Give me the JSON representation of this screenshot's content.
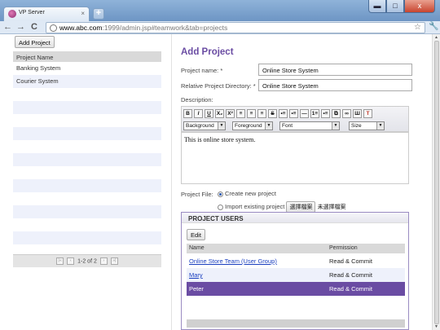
{
  "browser": {
    "tab_title": "VP Server",
    "tab_close": "×",
    "new_tab": "+",
    "url_host": "www.abc.com",
    "url_path": ":1999/admin.jsp#teamwork&tab=projects",
    "back": "←",
    "forward": "→",
    "reload": "C",
    "star": "☆",
    "wrench": "🔧",
    "min": "▬",
    "max": "□",
    "close": "x"
  },
  "projects": {
    "add_button": "Add Project",
    "header": "Project Name",
    "items": [
      "Banking System",
      "Courier System"
    ],
    "pager_text": "1-2 of 2",
    "pager_first": "|«",
    "pager_prev": "‹",
    "pager_next": "›",
    "pager_last": "»|"
  },
  "form": {
    "title": "Add Project",
    "name_label": "Project name: *",
    "name_value": "Online Store System",
    "dir_label": "Relative Project Directory: *",
    "dir_value": "Online Store System",
    "desc_label": "Description:",
    "description": "This is online store system.",
    "toolbar_buttons": [
      "B",
      "I",
      "U",
      "X₂",
      "X²",
      "≡",
      "≡",
      "≡",
      "S",
      "•≡",
      "•≡",
      "—",
      "1≡",
      "•≡",
      "⧉",
      "∞",
      "Ш",
      "T"
    ],
    "background_label": "Background",
    "foreground_label": "Foreground",
    "font_label": "Font",
    "size_label": "Size",
    "file_label": "Project File:",
    "create_option": "Create new project",
    "import_option": "Import existing project",
    "browse_button": "選擇檔案",
    "no_file_text": "未選擇檔案"
  },
  "users": {
    "title": "PROJECT USERS",
    "edit_button": "Edit",
    "col_name": "Name",
    "col_permission": "Permission",
    "rows": [
      {
        "name": "Online Store Team (User Group)",
        "permission": "Read & Commit"
      },
      {
        "name": "Mary",
        "permission": "Read & Commit"
      },
      {
        "name": "Peter",
        "permission": "Read & Commit"
      }
    ]
  },
  "colors": {
    "accent": "#6a4ca3",
    "link": "#1a3fbf",
    "row_alt": "#eef1fb"
  }
}
